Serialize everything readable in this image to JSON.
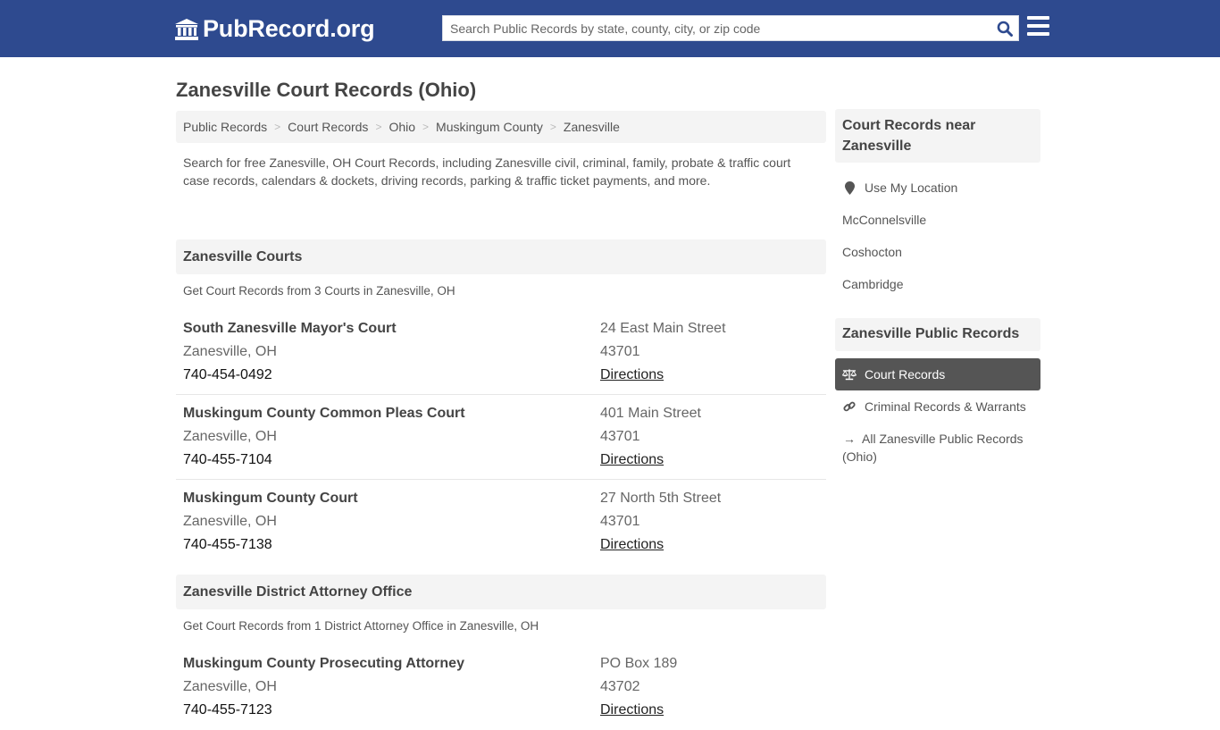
{
  "header": {
    "logo_text": "PubRecord.org",
    "search_placeholder": "Search Public Records by state, county, city, or zip code",
    "brand_color": "#2e4a8f"
  },
  "page": {
    "title": "Zanesville Court Records (Ohio)",
    "breadcrumb": [
      "Public Records",
      "Court Records",
      "Ohio",
      "Muskingum County",
      "Zanesville"
    ],
    "intro": "Search for free Zanesville, OH Court Records, including Zanesville civil, criminal, family, probate & traffic court case records, calendars & dockets, driving records, parking & traffic ticket payments, and more."
  },
  "sections": [
    {
      "title": "Zanesville Courts",
      "subtitle": "Get Court Records from 3 Courts in Zanesville, OH",
      "entries": [
        {
          "name": "South Zanesville Mayor's Court",
          "city": "Zanesville, OH",
          "phone": "740-454-0492",
          "address": "24 East Main Street",
          "zip": "43701",
          "directions": "Directions"
        },
        {
          "name": "Muskingum County Common Pleas Court",
          "city": "Zanesville, OH",
          "phone": "740-455-7104",
          "address": "401 Main Street",
          "zip": "43701",
          "directions": "Directions"
        },
        {
          "name": "Muskingum County Court",
          "city": "Zanesville, OH",
          "phone": "740-455-7138",
          "address": "27 North 5th Street",
          "zip": "43701",
          "directions": "Directions"
        }
      ]
    },
    {
      "title": "Zanesville District Attorney Office",
      "subtitle": "Get Court Records from 1 District Attorney Office in Zanesville, OH",
      "entries": [
        {
          "name": "Muskingum County Prosecuting Attorney",
          "city": "Zanesville, OH",
          "phone": "740-455-7123",
          "address": "PO Box 189",
          "zip": "43702",
          "directions": "Directions"
        }
      ]
    }
  ],
  "sidebar": {
    "nearby_title": "Court Records near Zanesville",
    "use_location": "Use My Location",
    "nearby": [
      "McConnelsville",
      "Coshocton",
      "Cambridge"
    ],
    "public_title": "Zanesville Public Records",
    "links": [
      {
        "label": "Court Records",
        "icon": "balance-scale-icon",
        "active": true
      },
      {
        "label": "Criminal Records & Warrants",
        "icon": "link-icon",
        "active": false
      },
      {
        "label": "All Zanesville Public Records (Ohio)",
        "icon": "arrow-right-icon",
        "active": false
      }
    ]
  }
}
